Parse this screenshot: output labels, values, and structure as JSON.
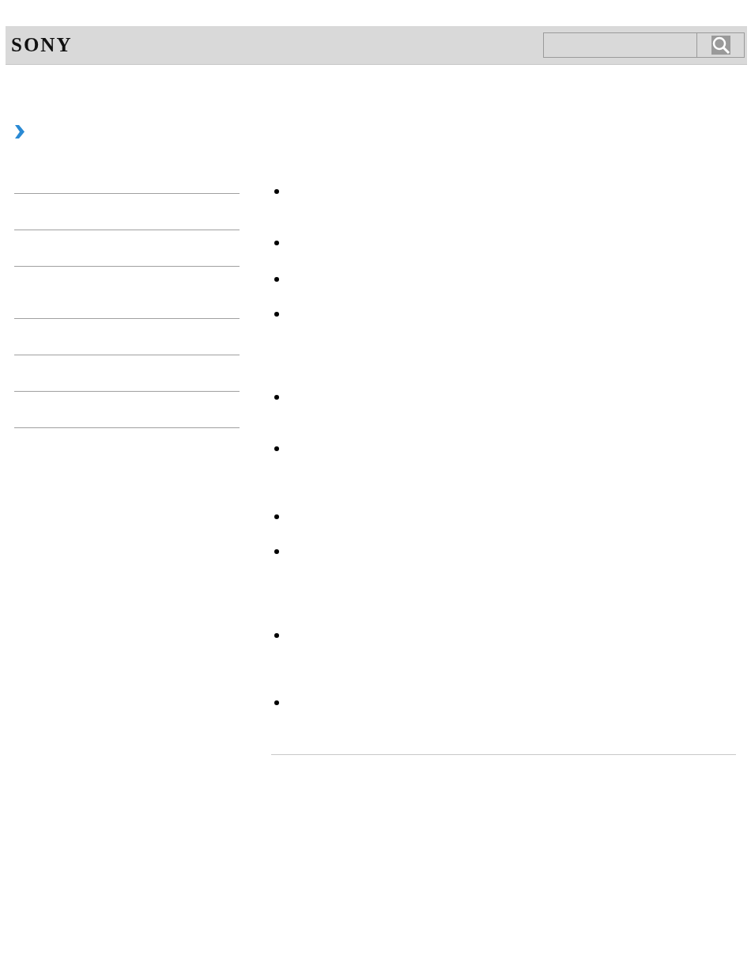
{
  "header": {
    "logo": "SONY"
  },
  "content": {
    "items": [
      {
        "kind": "bullet"
      },
      {
        "kind": "bullet"
      },
      {
        "kind": "bullet"
      },
      {
        "kind": "bullet"
      },
      {
        "kind": "bullet"
      },
      {
        "kind": "bullet"
      },
      {
        "kind": "bullet"
      },
      {
        "kind": "bullet"
      },
      {
        "kind": "bullet"
      },
      {
        "kind": "bullet"
      }
    ]
  }
}
